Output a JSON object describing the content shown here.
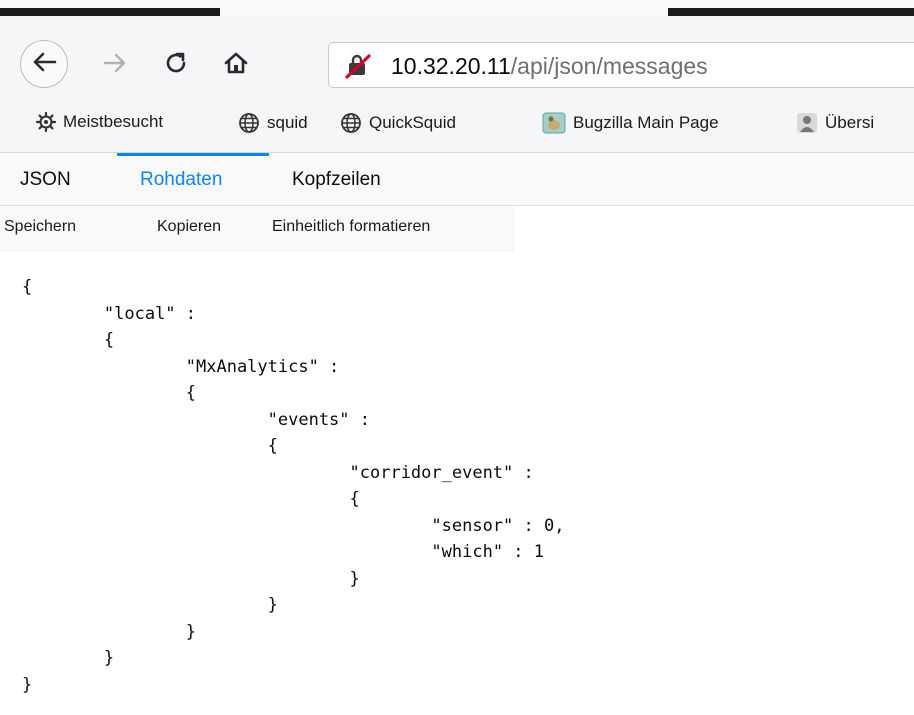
{
  "browser": {
    "url_host": "10.32.20.11",
    "url_path": "/api/json/messages",
    "icons": {
      "back": "back-arrow-icon",
      "forward": "forward-arrow-icon",
      "reload": "reload-icon",
      "home": "home-icon",
      "security": "insecure-connection-icon"
    }
  },
  "bookmarks": [
    {
      "label": "Meistbesucht",
      "icon": "gear-icon"
    },
    {
      "label": "squid",
      "icon": "globe-icon"
    },
    {
      "label": "QuickSquid",
      "icon": "globe-icon"
    },
    {
      "label": "Bugzilla Main Page",
      "icon": "bugzilla-icon"
    },
    {
      "label": "Übersi",
      "icon": "person-icon"
    }
  ],
  "viewer": {
    "tabs": [
      {
        "label": "JSON",
        "active": false
      },
      {
        "label": "Rohdaten",
        "active": true
      },
      {
        "label": "Kopfzeilen",
        "active": false
      }
    ],
    "actions": [
      "Speichern",
      "Kopieren",
      "Einheitlich formatieren"
    ]
  },
  "raw_json": "{\n\t\"local\" :\n\t{\n\t\t\"MxAnalytics\" :\n\t\t{\n\t\t\t\"events\" :\n\t\t\t{\n\t\t\t\t\"corridor_event\" :\n\t\t\t\t{\n\t\t\t\t\t\"sensor\" : 0,\n\t\t\t\t\t\"which\" : 1\n\t\t\t\t}\n\t\t\t}\n\t\t}\n\t}\n}",
  "colors": {
    "accent": "#0a84ff",
    "insecure": "#d70022"
  }
}
